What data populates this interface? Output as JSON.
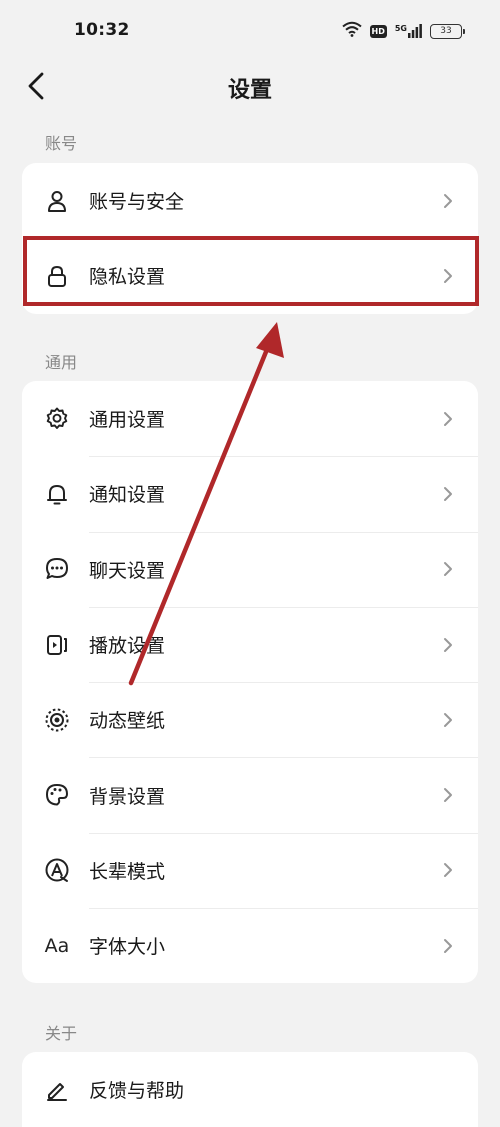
{
  "status": {
    "time": "10:32",
    "hd": "HD",
    "network": "5G",
    "battery": "33"
  },
  "header": {
    "title": "设置"
  },
  "sections": [
    {
      "label": "账号",
      "items": [
        {
          "label": "账号与安全",
          "icon": "person-icon"
        },
        {
          "label": "隐私设置",
          "icon": "lock-icon"
        }
      ]
    },
    {
      "label": "通用",
      "items": [
        {
          "label": "通用设置",
          "icon": "gear-icon"
        },
        {
          "label": "通知设置",
          "icon": "bell-icon"
        },
        {
          "label": "聊天设置",
          "icon": "chat-bubble-icon"
        },
        {
          "label": "播放设置",
          "icon": "playback-icon"
        },
        {
          "label": "动态壁纸",
          "icon": "live-wallpaper-icon"
        },
        {
          "label": "背景设置",
          "icon": "palette-icon"
        },
        {
          "label": "长辈模式",
          "icon": "elder-mode-icon"
        },
        {
          "label": "字体大小",
          "icon": "font-size-icon",
          "glyph": "Aa"
        }
      ]
    },
    {
      "label": "关于",
      "items": [
        {
          "label": "反馈与帮助",
          "icon": "pencil-icon"
        }
      ]
    }
  ],
  "colors": {
    "annotation": "#b0282a",
    "background": "#f2f2f2",
    "card": "#ffffff"
  }
}
